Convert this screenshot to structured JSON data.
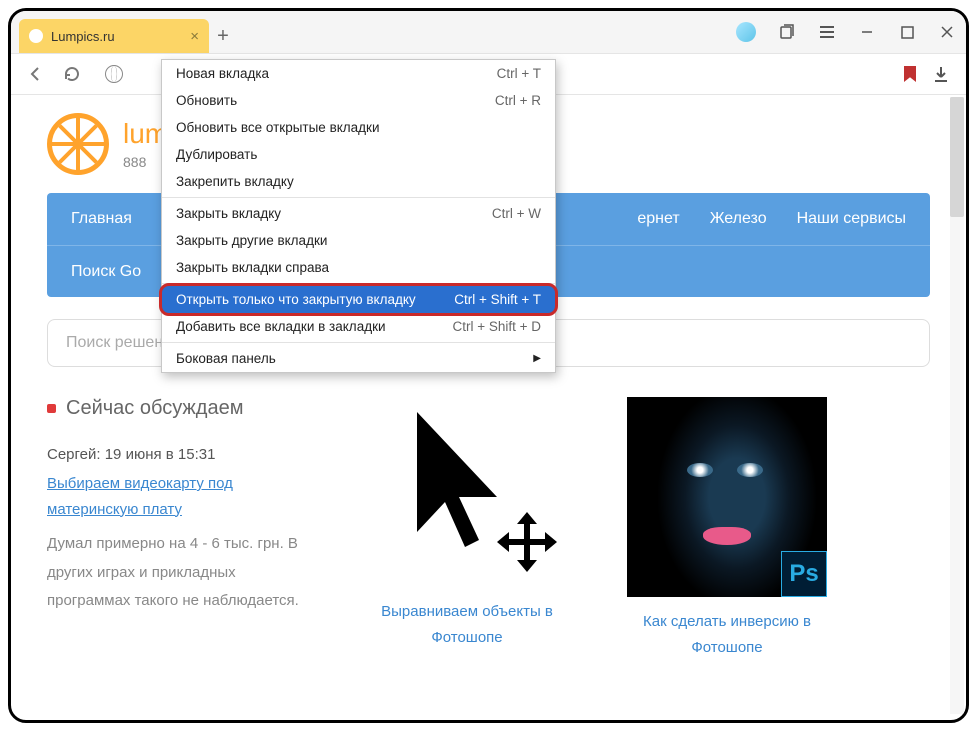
{
  "tab": {
    "title": "Lumpics.ru"
  },
  "site": {
    "name": "lumpics.ru",
    "phone": "888"
  },
  "nav": {
    "row1": [
      "Главная",
      "",
      "",
      "",
      "ернет",
      "Железо",
      "Наши сервисы"
    ],
    "row2": [
      "Поиск Go"
    ]
  },
  "search": {
    "placeholder": "Поиск решения..."
  },
  "discuss": {
    "title": "Сейчас обсуждаем",
    "meta": "Сергей: 19 июня в 15:31",
    "link": "Выбираем видеокарту под материнскую плату",
    "text": "Думал примерно на 4 - 6 тыс. грн. В других играх и прикладных программах такого не наблюдается."
  },
  "tiles": [
    {
      "title": "Выравниваем объекты в Фотошопе"
    },
    {
      "title": "Как сделать инверсию в Фотошопе"
    }
  ],
  "ps_badge": "Ps",
  "ctx": {
    "items": [
      {
        "label": "Новая вкладка",
        "shortcut": "Ctrl + T"
      },
      {
        "label": "Обновить",
        "shortcut": "Ctrl + R"
      },
      {
        "label": "Обновить все открытые вкладки",
        "shortcut": ""
      },
      {
        "label": "Дублировать",
        "shortcut": ""
      },
      {
        "label": "Закрепить вкладку",
        "shortcut": ""
      },
      {
        "label": "Закрыть вкладку",
        "shortcut": "Ctrl + W"
      },
      {
        "label": "Закрыть другие вкладки",
        "shortcut": ""
      },
      {
        "label": "Закрыть вкладки справа",
        "shortcut": ""
      },
      {
        "label": "Открыть только что закрытую вкладку",
        "shortcut": "Ctrl + Shift + T",
        "highlighted": true
      },
      {
        "label": "Добавить все вкладки в закладки",
        "shortcut": "Ctrl + Shift + D"
      },
      {
        "label": "Боковая панель",
        "submenu": true
      }
    ]
  }
}
